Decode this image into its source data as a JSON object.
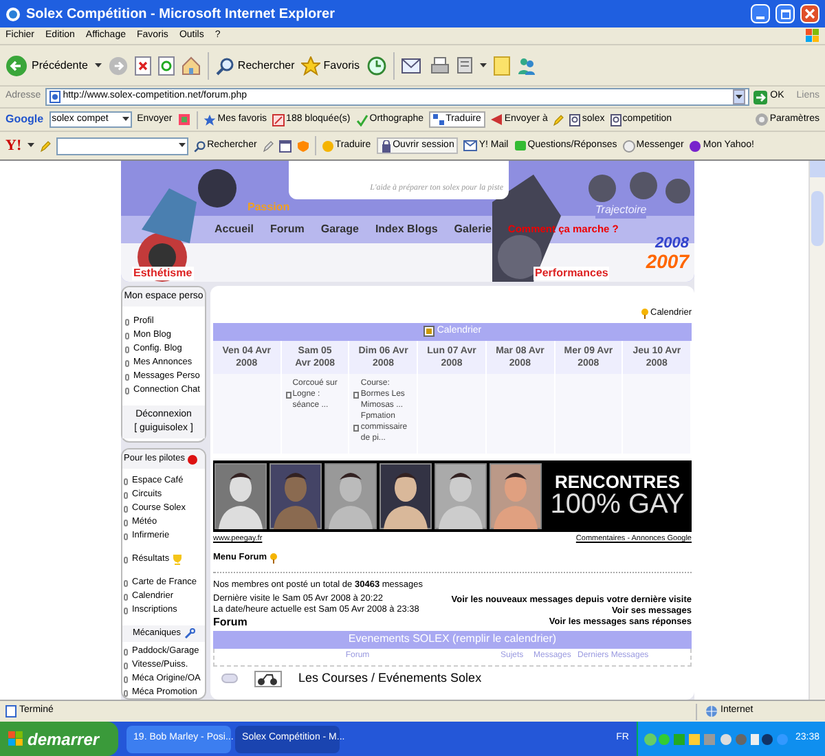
{
  "window": {
    "title": "Solex Compétition - Microsoft Internet Explorer"
  },
  "menu": [
    "Fichier",
    "Edition",
    "Affichage",
    "Favoris",
    "Outils",
    "?"
  ],
  "toolbar": {
    "back": "Précédente",
    "search": "Rechercher",
    "favorites": "Favoris"
  },
  "address_bar": {
    "label": "Adresse",
    "url": "http://www.solex-competition.net/forum.php",
    "go": "OK",
    "links": "Liens"
  },
  "google_bar": {
    "logo": "Google",
    "query": "solex compet",
    "send": "Envoyer",
    "favorites": "Mes favoris",
    "blocked": "188 bloquée(s)",
    "spelling": "Orthographe",
    "translate": "Traduire",
    "send_to": "Envoyer à",
    "terms": [
      "solex",
      "competition"
    ],
    "settings": "Paramètres"
  },
  "yahoo_bar": {
    "logo": "Y!",
    "search": "Rechercher",
    "translate": "Traduire",
    "sign_in": "Ouvrir session",
    "mail": "Y! Mail",
    "answers": "Questions/Réponses",
    "messenger": "Messenger",
    "my_yahoo": "Mon Yahoo!"
  },
  "banner": {
    "tagline": "L'aide à préparer ton solex pour la piste",
    "labels": [
      "Passion",
      "Trajectoire",
      "Esthétisme",
      "Performances"
    ],
    "years": [
      "2008",
      "2007"
    ],
    "nav": [
      {
        "label": "Accueil",
        "kind": "link"
      },
      {
        "label": "Forum",
        "kind": "link"
      },
      {
        "label": "Garage",
        "kind": "link"
      },
      {
        "label": "Index Blogs",
        "kind": "link"
      },
      {
        "label": "Galerie",
        "kind": "link"
      },
      {
        "label": "Comment ça marche ?",
        "kind": "highlight"
      }
    ]
  },
  "sidebar": {
    "personal": {
      "title": "Mon espace perso",
      "items": [
        "Profil",
        "Mon Blog",
        "Config. Blog",
        "Mes Annonces",
        "Messages Perso",
        "Connection Chat"
      ],
      "footer": [
        "Déconnexion",
        "[ guiguisolex ]"
      ]
    },
    "pilots": [
      {
        "kind": "heading",
        "label": "Pour les pilotes"
      },
      {
        "kind": "link",
        "label": "Espace Café"
      },
      {
        "kind": "link",
        "label": "Circuits"
      },
      {
        "kind": "link",
        "label": "Course Solex"
      },
      {
        "kind": "link",
        "label": "Météo"
      },
      {
        "kind": "link",
        "label": "Infirmerie"
      },
      {
        "kind": "award",
        "label": "Résultats"
      },
      {
        "kind": "link",
        "label": "Carte de France"
      },
      {
        "kind": "link",
        "label": "Calendrier"
      },
      {
        "kind": "link",
        "label": "Inscriptions"
      },
      {
        "kind": "heading",
        "label": "Mécaniques"
      },
      {
        "kind": "link",
        "label": "Paddock/Garage"
      },
      {
        "kind": "link",
        "label": "Vitesse/Puiss."
      },
      {
        "kind": "link",
        "label": "Méca Origine/OA"
      },
      {
        "kind": "link",
        "label": "Méca Promotion"
      }
    ]
  },
  "calendar": {
    "link": "Calendrier",
    "title": "Calendrier",
    "days": [
      {
        "date": "Ven 04 Avr 2008"
      },
      {
        "date": "Sam 05 Avr 2008",
        "events": [
          "Corcoué sur Logne : séance ..."
        ]
      },
      {
        "date": "Dim 06 Avr 2008",
        "events": [
          "Course: Bormes Les Mimosas ...",
          "Fpmation commissaire de pi..."
        ]
      },
      {
        "date": "Lun 07 Avr 2008"
      },
      {
        "date": "Mar 08 Avr 2008"
      },
      {
        "date": "Mer 09 Avr 2008"
      },
      {
        "date": "Jeu 10 Avr 2008"
      }
    ]
  },
  "ad": {
    "headline": "RENCONTRES",
    "subline": "100% GAY",
    "site": "www.peegay.fr",
    "credit": "Commentaires - Annonces Google"
  },
  "forum": {
    "menu_label": "Menu Forum",
    "stats": "Nos membres ont posté un total de **30463** messages",
    "last_visit": "Dernière visite le Sam 05 Avr 2008 à 20:22",
    "now": "La date/heure actuelle est Sam 05 Avr 2008 à 23:38",
    "title": "Forum",
    "links": [
      "Voir les nouveaux messages depuis votre dernière visite",
      "Voir ses messages",
      "Voir les messages sans réponses"
    ],
    "category": "Evenements SOLEX (remplir le calendrier)",
    "columns": [
      "Forum",
      "Sujets",
      "Messages",
      "Derniers Messages"
    ],
    "rows": [
      {
        "name": "Les Courses / Evénements Solex"
      }
    ]
  },
  "status_bar": {
    "text": "Terminé",
    "zone": "Internet"
  },
  "taskbar": {
    "start": "demarrer",
    "tasks": [
      {
        "label": "19. Bob Marley - Posi...",
        "selected": false
      },
      {
        "label": "Solex Compétition - M...",
        "selected": true
      }
    ],
    "language": "FR",
    "clock": "23:38"
  }
}
